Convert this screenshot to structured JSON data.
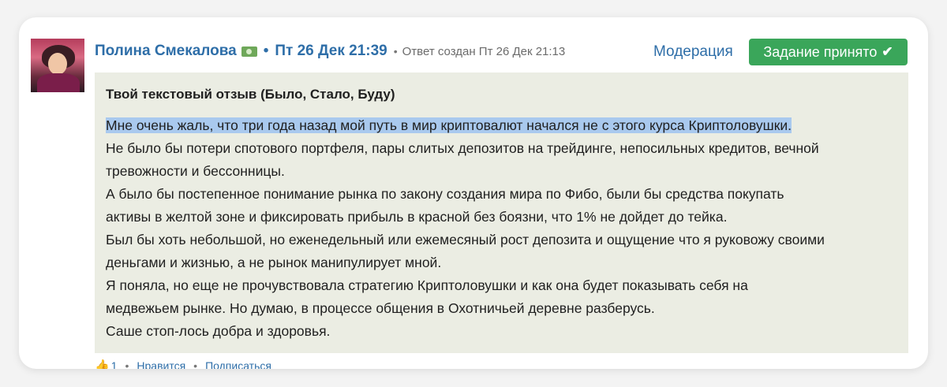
{
  "author": {
    "name": "Полина Смекалова",
    "badge_icon": "money-icon",
    "avatar": "avatar"
  },
  "post": {
    "date": "Пт 26 Дек 21:39",
    "created": "Ответ создан Пт 26 Дек 21:13"
  },
  "actions": {
    "moderation_label": "Модерация",
    "accepted_label": "Задание принято",
    "accepted_color": "#3aa65a"
  },
  "answer": {
    "title": "Твой текстовый отзыв (Было, Стало, Буду)",
    "highlighted_line": "Мне очень жаль, что три года назад мой путь в мир криптовалют начался не с этого курса Криптоловушки.",
    "lines": [
      "Не было бы потери спотового портфеля, пары слитых депозитов на трейдинге, непосильных кредитов, вечной",
      "тревожности и бессонницы.",
      "А было бы постепенное понимание рынка по закону создания мира по Фибо, были бы средства покупать",
      "активы в желтой зоне и фиксировать прибыль в красной без боязни, что 1% не дойдет до тейка.",
      "Был бы хоть небольшой, но еженедельный или ежемесяный рост депозита и ощущение что я руковожу своими",
      "деньгами и жизнью, а не рынок манипулирует мной.",
      "Я поняла, но еще не прочувствовала стратегию Криптоловушки и как она будет показывать себя на",
      "медвежьем рынке. Но думаю, в процессе общения в Охотничьей деревне разберусь.",
      "Саше стоп-лось добра и здоровья."
    ],
    "background_color": "#ebede3",
    "highlight_color": "#a9c9ee"
  },
  "footer": {
    "like_count": "1",
    "like_label": "Нравится",
    "subscribe_label": "Подписаться"
  },
  "colors": {
    "link": "#2e6ea8"
  }
}
